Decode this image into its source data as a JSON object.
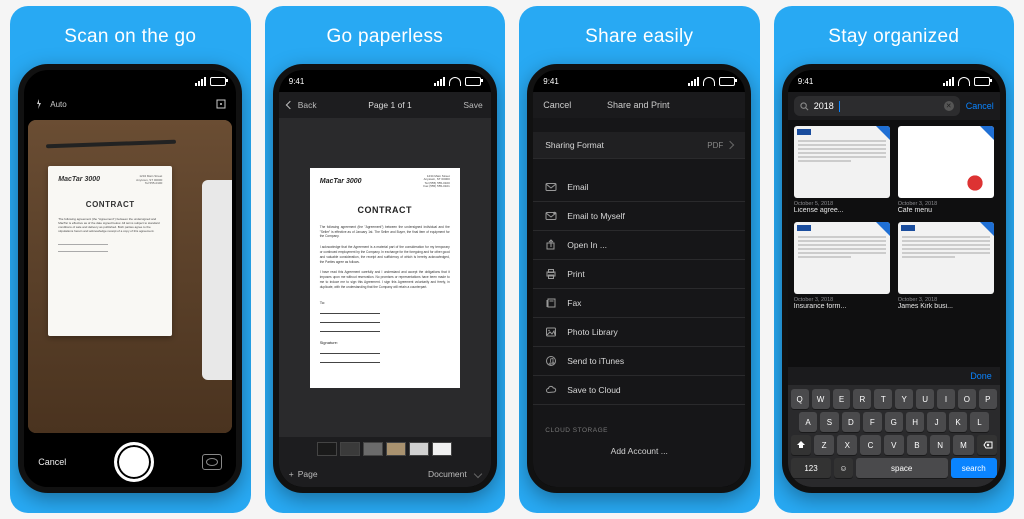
{
  "panels": [
    {
      "title": "Scan on the go"
    },
    {
      "title": "Go paperless"
    },
    {
      "title": "Share easily"
    },
    {
      "title": "Stay organized"
    }
  ],
  "status_time": "9:41",
  "p1": {
    "auto_label": "Auto",
    "doc_logo": "MacTar 3000",
    "doc_title": "CONTRACT",
    "cancel": "Cancel"
  },
  "p2": {
    "back": "Back",
    "page_indicator": "Page 1 of 1",
    "save": "Save",
    "doc_logo": "MacTar 3000",
    "doc_title": "CONTRACT",
    "sig_to": "To:",
    "sig_sign": "Signature:",
    "swatches": [
      "#1a1a1a",
      "#3a3a3a",
      "#6b6b6b",
      "#a9926f",
      "#d0d0d0",
      "#f0f0f0"
    ],
    "add_page": "Page",
    "document": "Document"
  },
  "p3": {
    "cancel": "Cancel",
    "title": "Share and Print",
    "format_label": "Sharing Format",
    "format_value": "PDF",
    "items": [
      {
        "icon": "envelope",
        "label": "Email"
      },
      {
        "icon": "envelope-self",
        "label": "Email to Myself"
      },
      {
        "icon": "open-in",
        "label": "Open In ..."
      },
      {
        "icon": "printer",
        "label": "Print"
      },
      {
        "icon": "fax",
        "label": "Fax"
      },
      {
        "icon": "photo",
        "label": "Photo Library"
      },
      {
        "icon": "itunes",
        "label": "Send to iTunes"
      },
      {
        "icon": "cloud",
        "label": "Save to Cloud"
      }
    ],
    "cloud_section": "CLOUD STORAGE",
    "add_account": "Add Account ..."
  },
  "p4": {
    "search_query": "2018",
    "cancel": "Cancel",
    "done": "Done",
    "results": [
      {
        "date": "October 5, 2018",
        "name": "License agree...",
        "style": "doc"
      },
      {
        "date": "October 3, 2018",
        "name": "Cafe menu",
        "style": "menu"
      },
      {
        "date": "October 3, 2018",
        "name": "Insurance form...",
        "style": "doc"
      },
      {
        "date": "October 3, 2018",
        "name": "James Kirk busi...",
        "style": "doc"
      }
    ],
    "kb": {
      "r1": [
        "Q",
        "W",
        "E",
        "R",
        "T",
        "Y",
        "U",
        "I",
        "O",
        "P"
      ],
      "r2": [
        "A",
        "S",
        "D",
        "F",
        "G",
        "H",
        "J",
        "K",
        "L"
      ],
      "r3": [
        "Z",
        "X",
        "C",
        "V",
        "B",
        "N",
        "M"
      ],
      "num": "123",
      "space": "space",
      "search": "search"
    }
  }
}
